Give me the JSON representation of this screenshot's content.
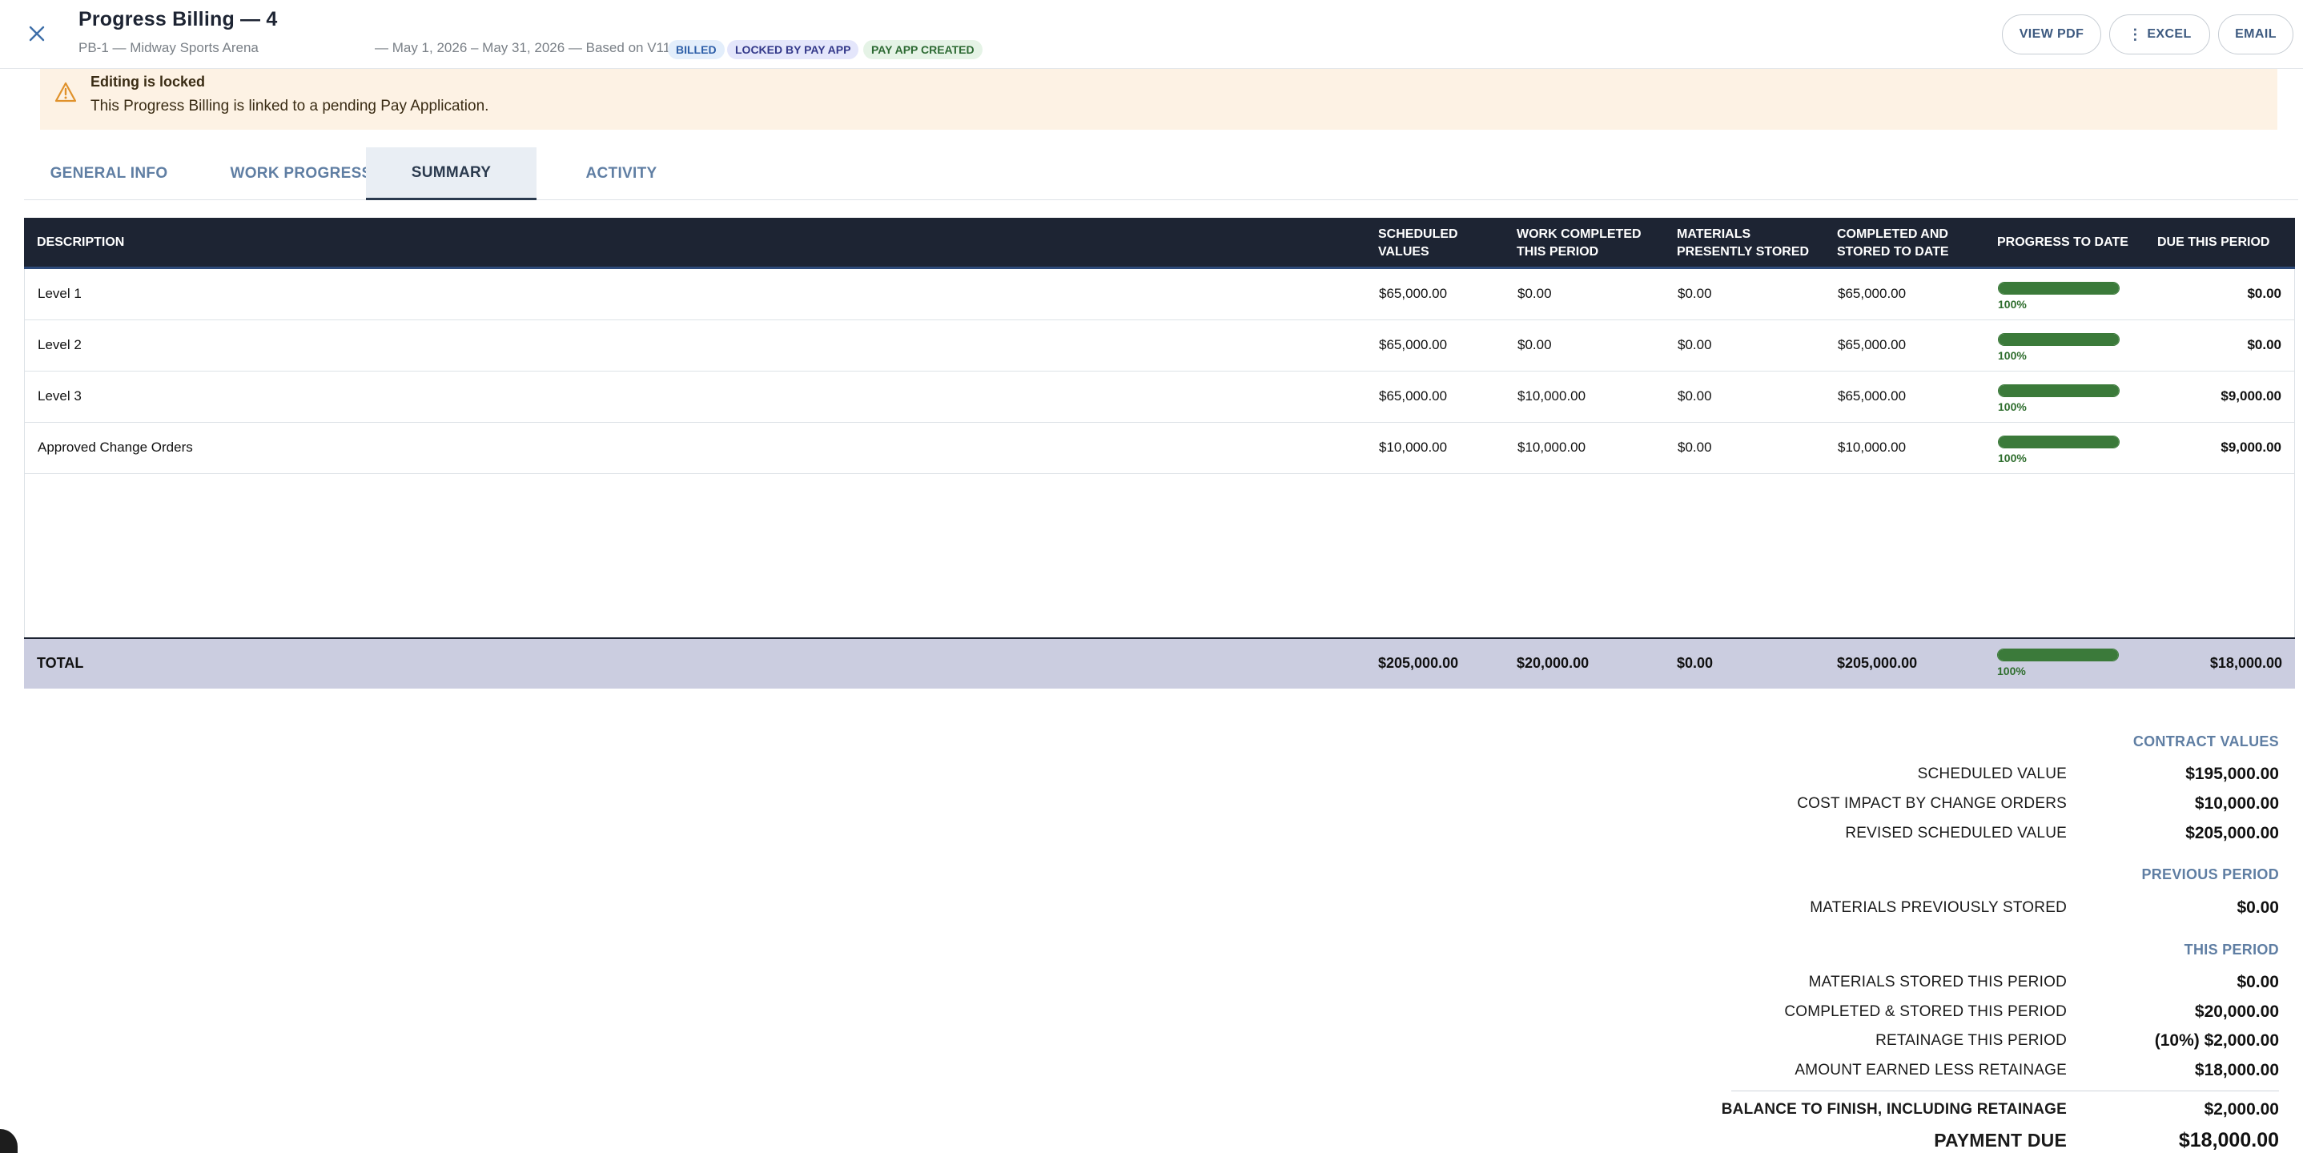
{
  "header": {
    "title": "Progress Billing — 4",
    "subtitle_project": "PB-1 — Midway Sports Arena",
    "subtitle_period": "— May 1, 2026 – May 31, 2026 — Based on V11",
    "badges": [
      "BILLED",
      "LOCKED BY PAY APP",
      "PAY APP CREATED"
    ],
    "buttons": {
      "pdf": "VIEW PDF",
      "excel": "EXCEL",
      "email": "EMAIL"
    }
  },
  "banner": {
    "title": "Editing is locked",
    "text": "This Progress Billing is linked to a pending Pay Application."
  },
  "tabs": [
    "GENERAL INFO",
    "WORK PROGRESS",
    "SUMMARY",
    "ACTIVITY"
  ],
  "active_tab": "SUMMARY",
  "table": {
    "columns": [
      "DESCRIPTION",
      "SCHEDULED\nVALUES",
      "WORK COMPLETED\nTHIS PERIOD",
      "MATERIALS\nPRESENTLY STORED",
      "COMPLETED AND\nSTORED TO DATE",
      "PROGRESS TO DATE",
      "DUE THIS PERIOD"
    ],
    "rows": [
      {
        "description": "Level 1",
        "scheduled": "$65,000.00",
        "work_period": "$0.00",
        "materials": "$0.00",
        "to_date": "$65,000.00",
        "progress": 1.0,
        "progress_label": "100%",
        "due": "$0.00"
      },
      {
        "description": "Level 2",
        "scheduled": "$65,000.00",
        "work_period": "$0.00",
        "materials": "$0.00",
        "to_date": "$65,000.00",
        "progress": 1.0,
        "progress_label": "100%",
        "due": "$0.00"
      },
      {
        "description": "Level 3",
        "scheduled": "$65,000.00",
        "work_period": "$10,000.00",
        "materials": "$0.00",
        "to_date": "$65,000.00",
        "progress": 1.0,
        "progress_label": "100%",
        "due": "$9,000.00"
      },
      {
        "description": "Approved Change Orders",
        "scheduled": "$10,000.00",
        "work_period": "$10,000.00",
        "materials": "$0.00",
        "to_date": "$10,000.00",
        "progress": 1.0,
        "progress_label": "100%",
        "due": "$9,000.00"
      }
    ],
    "total": {
      "description": "TOTAL",
      "scheduled": "$205,000.00",
      "work_period": "$20,000.00",
      "materials": "$0.00",
      "to_date": "$205,000.00",
      "progress": 1.0,
      "progress_label": "100%",
      "due": "$18,000.00"
    }
  },
  "summary": {
    "contract_values_heading": "CONTRACT VALUES",
    "scheduled_value_label": "SCHEDULED VALUE",
    "scheduled_value": "$195,000.00",
    "change_orders_label": "COST IMPACT BY CHANGE ORDERS",
    "change_orders": "$10,000.00",
    "revised_label": "REVISED SCHEDULED VALUE",
    "revised": "$205,000.00",
    "previous_heading": "PREVIOUS PERIOD",
    "materials_prev_label": "MATERIALS PREVIOUSLY STORED",
    "materials_prev": "$0.00",
    "this_heading": "THIS PERIOD",
    "materials_this_label": "MATERIALS STORED THIS PERIOD",
    "materials_this": "$0.00",
    "completed_label": "COMPLETED & STORED THIS PERIOD",
    "completed": "$20,000.00",
    "retainage_label": "RETAINAGE THIS PERIOD",
    "retainage": "(10%) $2,000.00",
    "earned_label": "AMOUNT EARNED LESS RETAINAGE",
    "earned": "$18,000.00",
    "balance_label": "BALANCE TO FINISH, INCLUDING RETAINAGE",
    "balance": "$2,000.00",
    "payment_label": "PAYMENT DUE",
    "payment": "$18,000.00"
  },
  "colors": {
    "header_bg": "#1d2433",
    "progress": "#3b7a3a",
    "total_bg": "#cbcde0",
    "banner_bg": "#fdf2e4",
    "accent": "#5f7ea3"
  }
}
